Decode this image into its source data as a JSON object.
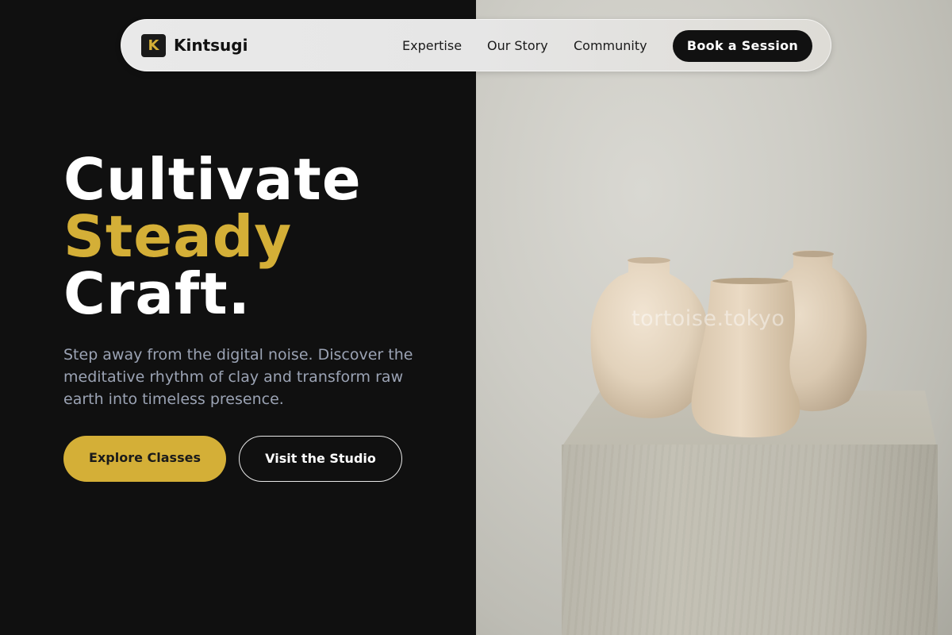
{
  "nav": {
    "logo_letter": "K",
    "brand": "Kintsugi",
    "links": [
      "Expertise",
      "Our Story",
      "Community"
    ],
    "cta": "Book a Session"
  },
  "hero": {
    "headline_line1": "Cultivate",
    "headline_line2": "Steady",
    "headline_line3": "Craft.",
    "subtext": "Step away from the digital noise. Discover the meditative rhythm of clay and transform raw earth into timeless presence.",
    "primary_button": "Explore Classes",
    "secondary_button": "Visit the Studio"
  },
  "image": {
    "watermark": "tortoise.tokyo"
  },
  "colors": {
    "accent": "#d4af37",
    "background": "#101010",
    "subtext": "#9ba3b4"
  }
}
